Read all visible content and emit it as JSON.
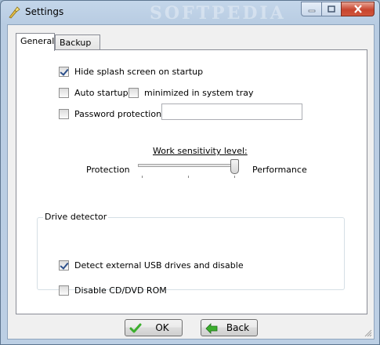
{
  "window": {
    "title": "Settings",
    "watermark": "SOFTPEDIA"
  },
  "tabs": [
    {
      "label": "General",
      "active": true
    },
    {
      "label": "Backup",
      "active": false
    }
  ],
  "general": {
    "hide_splash": {
      "label": "Hide splash screen on startup",
      "checked": true
    },
    "auto_startup": {
      "label": "Auto startup",
      "checked": false
    },
    "minimized_tray": {
      "label": "minimized in system tray",
      "checked": false
    },
    "password_protection": {
      "label": "Password protection:",
      "checked": false,
      "value": ""
    },
    "sensitivity": {
      "title": "Work sensitivity level:",
      "left_label": "Protection",
      "right_label": "Performance",
      "value": 1.0
    }
  },
  "drive_detector": {
    "title": "Drive detector",
    "detect_usb": {
      "label": "Detect external USB drives and disable",
      "checked": true
    },
    "disable_cd": {
      "label": "Disable CD/DVD ROM",
      "checked": false
    }
  },
  "buttons": {
    "ok": "OK",
    "back": "Back"
  },
  "colors": {
    "check_mark": "#2b4f8a",
    "ok_icon": "#3cae2e",
    "back_icon": "#3cae2e"
  }
}
